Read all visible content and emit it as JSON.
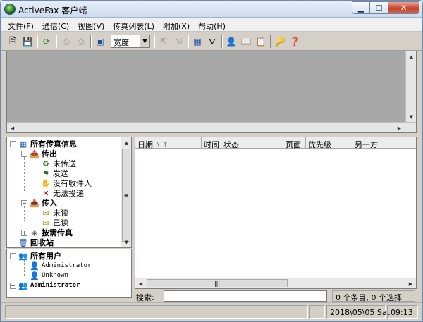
{
  "window": {
    "title": "ActiveFax 客户端"
  },
  "menu": [
    "文件(F)",
    "通信(C)",
    "视图(V)",
    "传真列表(L)",
    "附加(X)",
    "帮助(H)"
  ],
  "toolbar": {
    "zoom_value": "宽度"
  },
  "tree": {
    "root": "所有传真信息",
    "outgoing": "传出",
    "not_sent": "未传送",
    "sent": "发送",
    "no_recipient": "没有收件人",
    "undeliverable": "无法投递",
    "incoming": "传入",
    "unread": "未读",
    "read": "己读",
    "on_demand": "按需传真",
    "recycle": "回收站"
  },
  "users": {
    "all_users": "所有用户",
    "items": [
      "Administrator",
      "Unknown"
    ],
    "admin_group": "Administrator"
  },
  "list": {
    "columns": [
      "日期",
      "时间",
      "状态",
      "页面",
      "优先级",
      "另一方"
    ],
    "sort_indicator": "\\ ↑"
  },
  "search": {
    "label": "搜索:",
    "value": ""
  },
  "counts": "0 个条目, 0 个选择",
  "status": {
    "date": "2018\\05\\05 Sat",
    "time": "09:13"
  }
}
